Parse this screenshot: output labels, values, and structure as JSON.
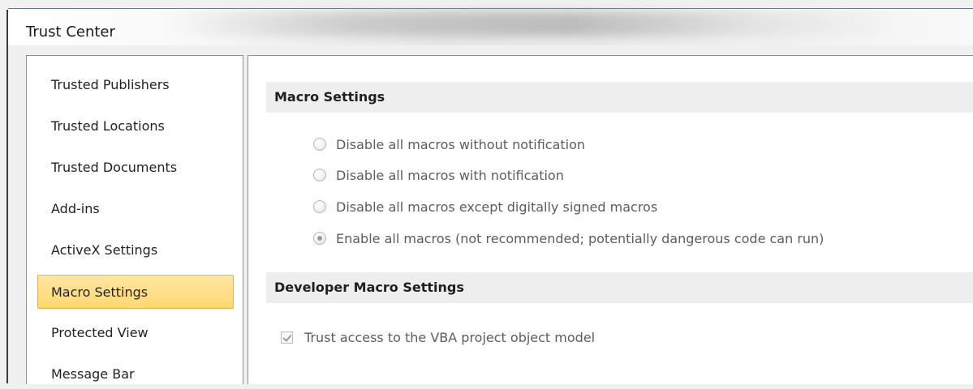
{
  "window": {
    "title": "Trust Center"
  },
  "sidebar": {
    "items": [
      {
        "label": "Trusted Publishers",
        "selected": false
      },
      {
        "label": "Trusted Locations",
        "selected": false
      },
      {
        "label": "Trusted Documents",
        "selected": false
      },
      {
        "label": "Add-ins",
        "selected": false
      },
      {
        "label": "ActiveX Settings",
        "selected": false
      },
      {
        "label": "Macro Settings",
        "selected": true
      },
      {
        "label": "Protected View",
        "selected": false
      },
      {
        "label": "Message Bar",
        "selected": false
      }
    ]
  },
  "macro_settings": {
    "heading": "Macro Settings",
    "options": [
      {
        "label": "Disable all macros without notification",
        "checked": false
      },
      {
        "label": "Disable all macros with notification",
        "checked": false
      },
      {
        "label": "Disable all macros except digitally signed macros",
        "checked": false
      },
      {
        "label": "Enable all macros (not recommended; potentially dangerous code can run)",
        "checked": true
      }
    ]
  },
  "developer_macro_settings": {
    "heading": "Developer Macro Settings",
    "trust_vba_label": "Trust access to the VBA project object model",
    "trust_vba_checked": true
  },
  "colors": {
    "selected_item_bg": "#fdd772",
    "selected_item_border": "#e5b34a",
    "section_header_bg": "#eeeeee"
  }
}
